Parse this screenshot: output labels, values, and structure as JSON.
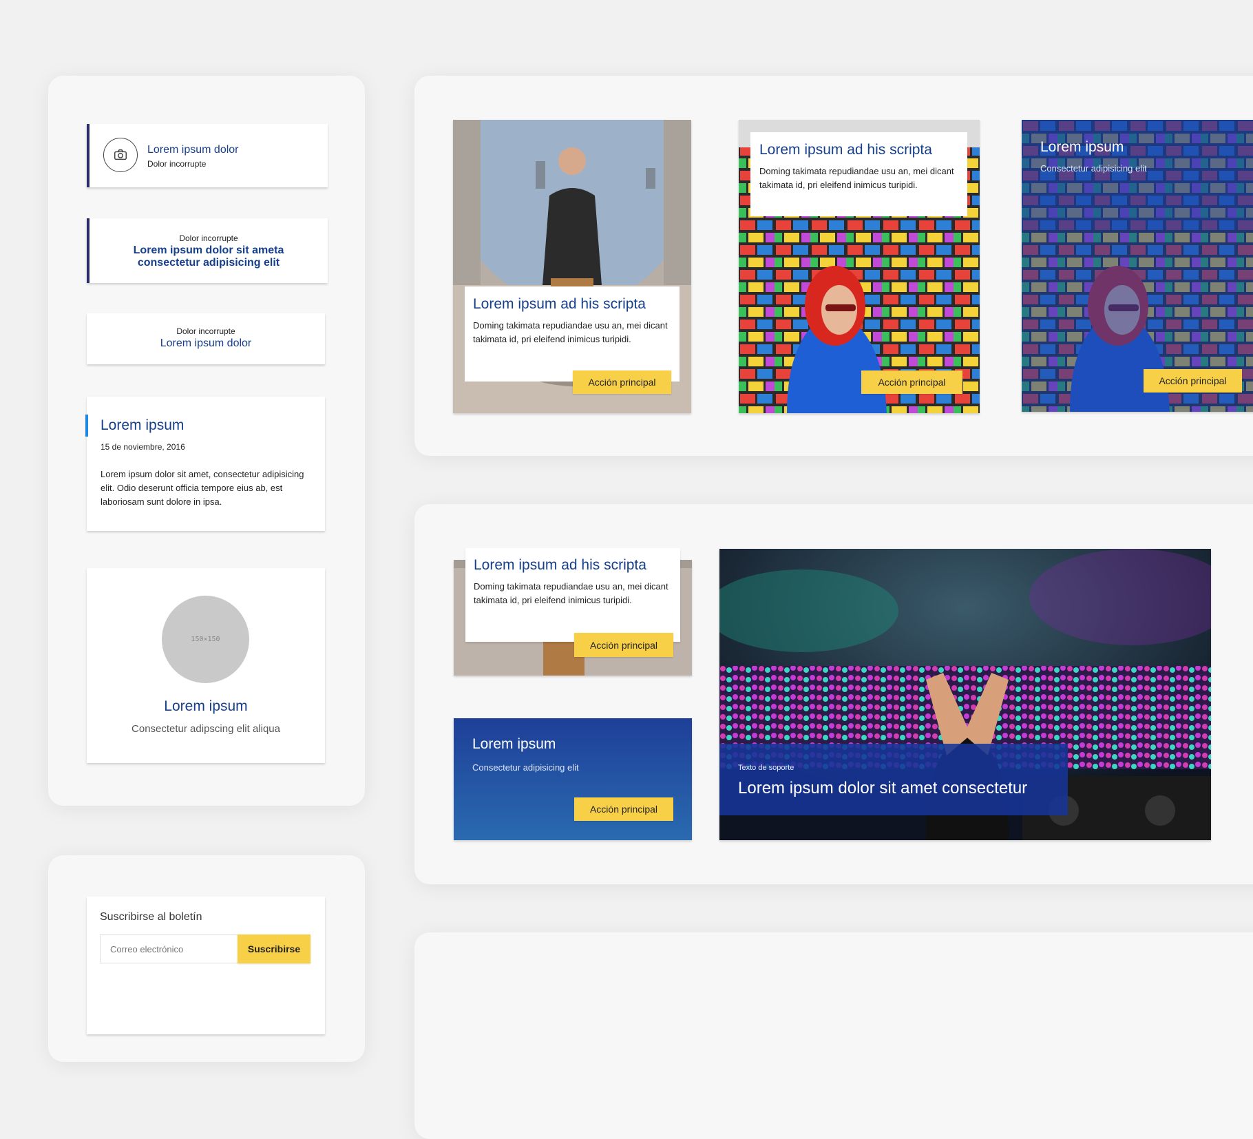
{
  "colors": {
    "brand_blue": "#163f8c",
    "accent_yellow": "#f7d048",
    "left_border": "#2c2c6b",
    "highlight_blue": "#1e88e5"
  },
  "left": {
    "card1": {
      "title": "Lorem ipsum dolor",
      "subtitle": "Dolor incorrupte",
      "icon": "camera-icon"
    },
    "card2": {
      "kicker": "Dolor incorrupte",
      "title_line1": "Lorem ipsum dolor sit ameta",
      "title_line2": "consectetur adipisicing elit"
    },
    "card3": {
      "kicker": "Dolor incorrupte",
      "title": "Lorem ipsum dolor"
    },
    "card4": {
      "title": "Lorem ipsum",
      "date": "15 de noviembre, 2016",
      "body": "Lorem ipsum dolor sit amet, consectetur adipisicing elit. Odio deserunt officia tempore eius ab, est laboriosam sunt dolore in ipsa."
    },
    "card5": {
      "avatar_text": "150×150",
      "title": "Lorem ipsum",
      "subtitle": "Consectetur adipscing elit aliqua"
    },
    "newsletter": {
      "title": "Suscribirse al boletín",
      "placeholder": "Correo electrónico",
      "button": "Suscribirse"
    }
  },
  "top": {
    "card1": {
      "title": "Lorem ipsum ad his scripta",
      "body": "Doming takimata repudiandae usu an, mei dicant takimata id, pri eleifend inimicus turipidi.",
      "button": "Acción principal"
    },
    "card2": {
      "title": "Lorem ipsum ad his scripta",
      "body": "Doming takimata repudiandae usu an, mei dicant takimata id, pri eleifend inimicus turipidi.",
      "button": "Acción principal"
    },
    "card3": {
      "title": "Lorem ipsum",
      "subtitle": "Consectetur adipisicing elit",
      "button": "Acción principal"
    }
  },
  "bottom": {
    "card1": {
      "title": "Lorem ipsum ad his scripta",
      "body": "Doming takimata repudiandae usu an, mei dicant takimata id, pri eleifend inimicus turipidi.",
      "button": "Acción principal"
    },
    "card2": {
      "title": "Lorem ipsum",
      "subtitle": "Consectetur adipisicing elit",
      "button": "Acción principal"
    },
    "hero": {
      "kicker": "Texto de soporte",
      "title": "Lorem ipsum dolor sit amet consectetur"
    }
  }
}
